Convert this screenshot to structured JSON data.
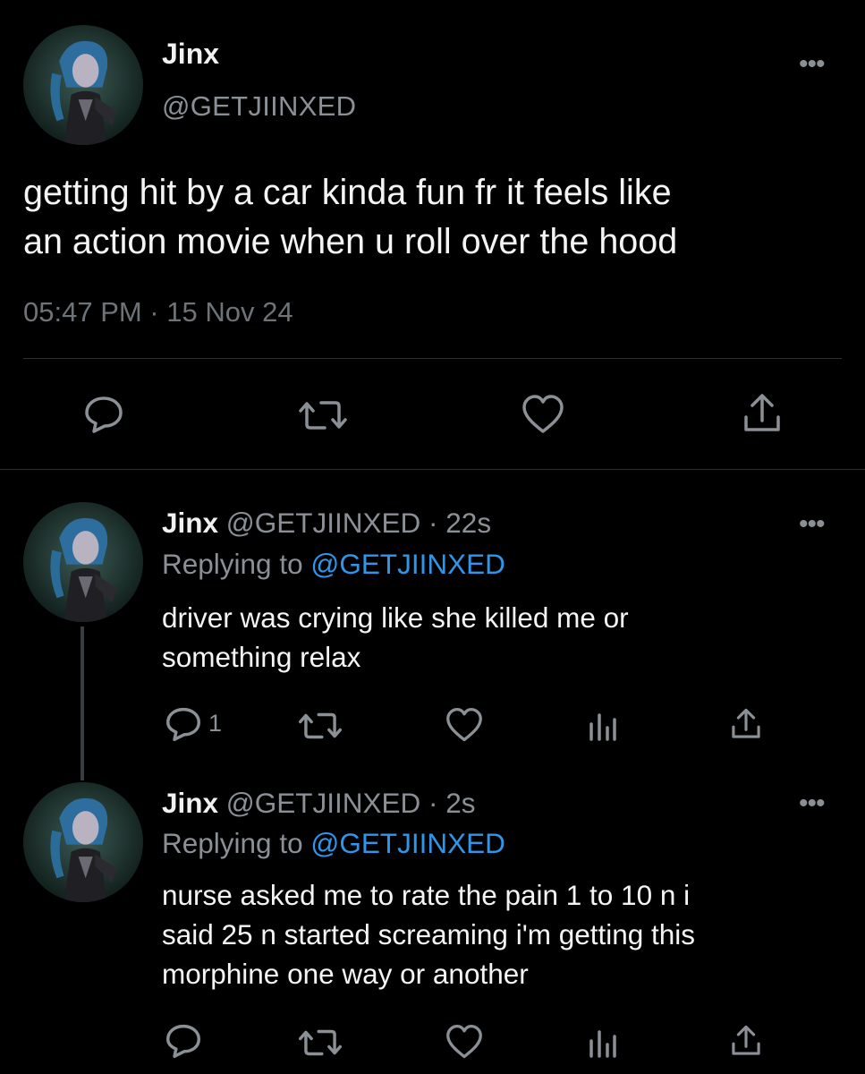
{
  "main_tweet": {
    "name": "Jinx",
    "handle": "@GETJIINXED",
    "text": "getting hit by a car kinda fun fr it feels like\nan action movie when u roll over the hood",
    "timestamp": "05:47 PM · 15 Nov 24",
    "more": "•••",
    "actions": [
      "reply-icon",
      "retweet-icon",
      "like-icon",
      "share-icon"
    ]
  },
  "replies": [
    {
      "name": "Jinx",
      "handle_time": "@GETJIINXED · 22s",
      "replying_prefix": "Replying to ",
      "replying_to": "@GETJIINXED",
      "text": "driver was crying like she killed me or\nsomething relax",
      "reply_count": "1",
      "more": "•••"
    },
    {
      "name": "Jinx",
      "handle_time": "@GETJIINXED · 2s",
      "replying_prefix": "Replying to ",
      "replying_to": "@GETJIINXED",
      "text": "nurse asked me to rate the pain 1 to 10 n i\nsaid 25 n started screaming i'm getting this\nmorphine one way or another",
      "reply_count": "",
      "more": "•••"
    }
  ],
  "colors": {
    "background": "#000000",
    "text": "#f4f4f4",
    "muted": "#8b9096",
    "mention": "#2f96ea",
    "divider": "#2c2f32"
  }
}
